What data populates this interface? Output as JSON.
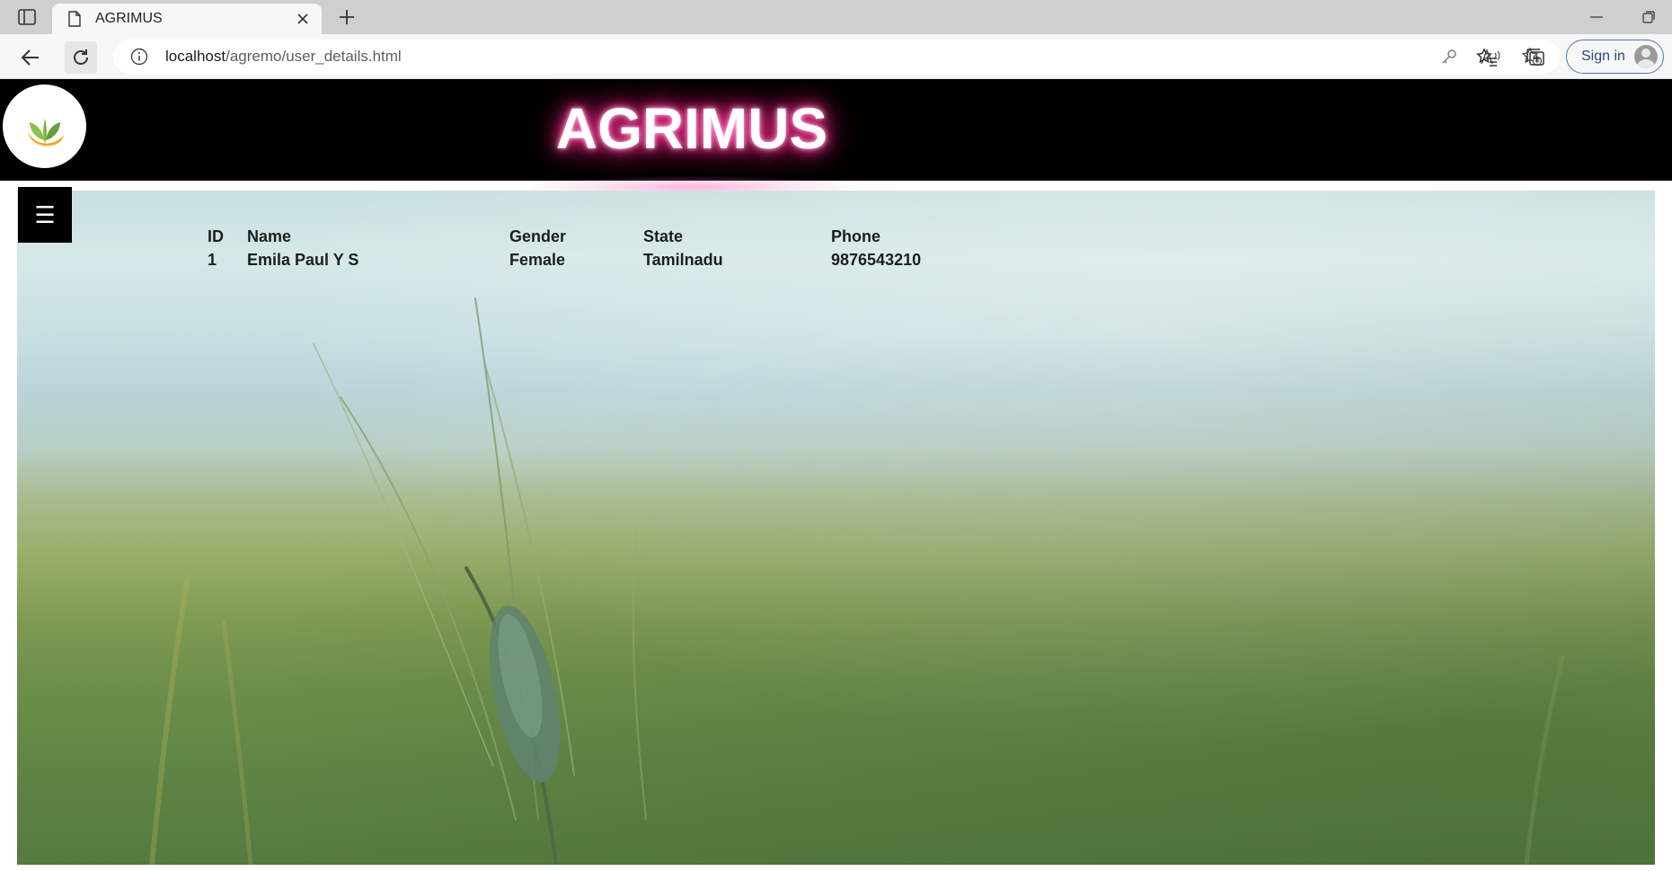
{
  "browser": {
    "tab_title": "AGRIMUS",
    "url_host": "localhost",
    "url_path": "/agremo/user_details.html",
    "sign_in_label": "Sign in"
  },
  "site": {
    "title": "AGRIMUS",
    "menu_icon": "☰"
  },
  "users_table": {
    "headers": [
      "ID",
      "Name",
      "Gender",
      "State",
      "Phone"
    ],
    "rows": [
      [
        "1",
        "Emila Paul Y S",
        "Female",
        "Tamilnadu",
        "9876543210"
      ]
    ]
  },
  "colors": {
    "header_bg": "#000000",
    "title_glow": "#ff2f95",
    "signin_border": "#5577aa"
  },
  "icons": {
    "tab_actions": "tab-actions-icon",
    "page": "page-icon",
    "close": "close-icon",
    "new_tab": "plus-icon",
    "back": "arrow-left-icon",
    "reload": "reload-icon",
    "info": "info-icon",
    "key": "key-icon",
    "read_aloud": "read-aloud-icon",
    "add_favorite": "star-add-icon",
    "favorites": "favorites-icon",
    "collections": "collections-icon",
    "logo": "leaf-logo-icon"
  }
}
